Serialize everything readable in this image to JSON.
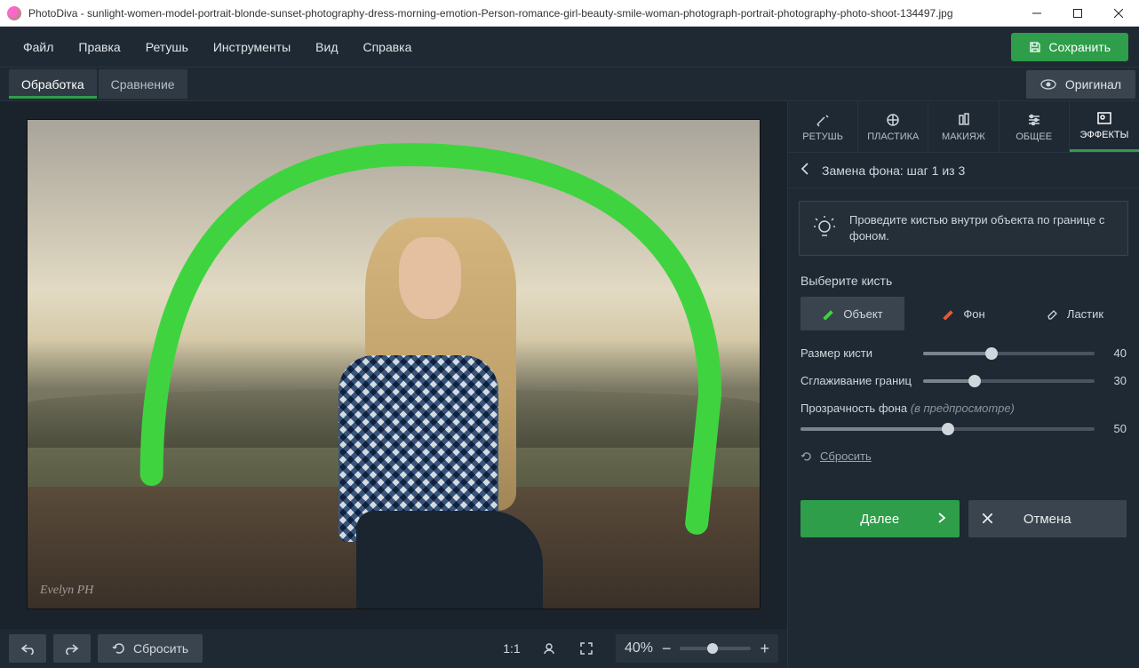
{
  "titlebar": {
    "app": "PhotoDiva",
    "file": "sunlight-women-model-portrait-blonde-sunset-photography-dress-morning-emotion-Person-romance-girl-beauty-smile-woman-photograph-portrait-photography-photo-shoot-134497.jpg"
  },
  "menu": {
    "file": "Файл",
    "edit": "Правка",
    "retouch": "Ретушь",
    "tools": "Инструменты",
    "view": "Вид",
    "help": "Справка"
  },
  "save_label": "Сохранить",
  "tabs": {
    "process": "Обработка",
    "compare": "Сравнение",
    "original": "Оригинал"
  },
  "side_tabs": {
    "retouch": "РЕТУШЬ",
    "plastic": "ПЛАСТИКА",
    "makeup": "МАКИЯЖ",
    "general": "ОБЩЕЕ",
    "effects": "ЭФФЕКТЫ"
  },
  "crumb": "Замена фона: шаг 1 из 3",
  "tip": "Проведите кистью внутри объекта по границе с фоном.",
  "brush": {
    "heading": "Выберите кисть",
    "object": "Объект",
    "background": "Фон",
    "eraser": "Ластик"
  },
  "sliders": {
    "size": {
      "label": "Размер кисти",
      "value": 40,
      "max": 100
    },
    "smooth": {
      "label": "Сглаживание границ",
      "value": 30,
      "max": 100
    },
    "opacity": {
      "label_a": "Прозрачность фона ",
      "label_b": "(в предпросмотре)",
      "value": 50,
      "max": 100
    }
  },
  "reset_link": "Сбросить",
  "actions": {
    "next": "Далее",
    "cancel": "Отмена"
  },
  "bottom": {
    "reset": "Сбросить",
    "ratio": "1:1",
    "zoom": "40%"
  },
  "watermark": "Evelyn PH"
}
